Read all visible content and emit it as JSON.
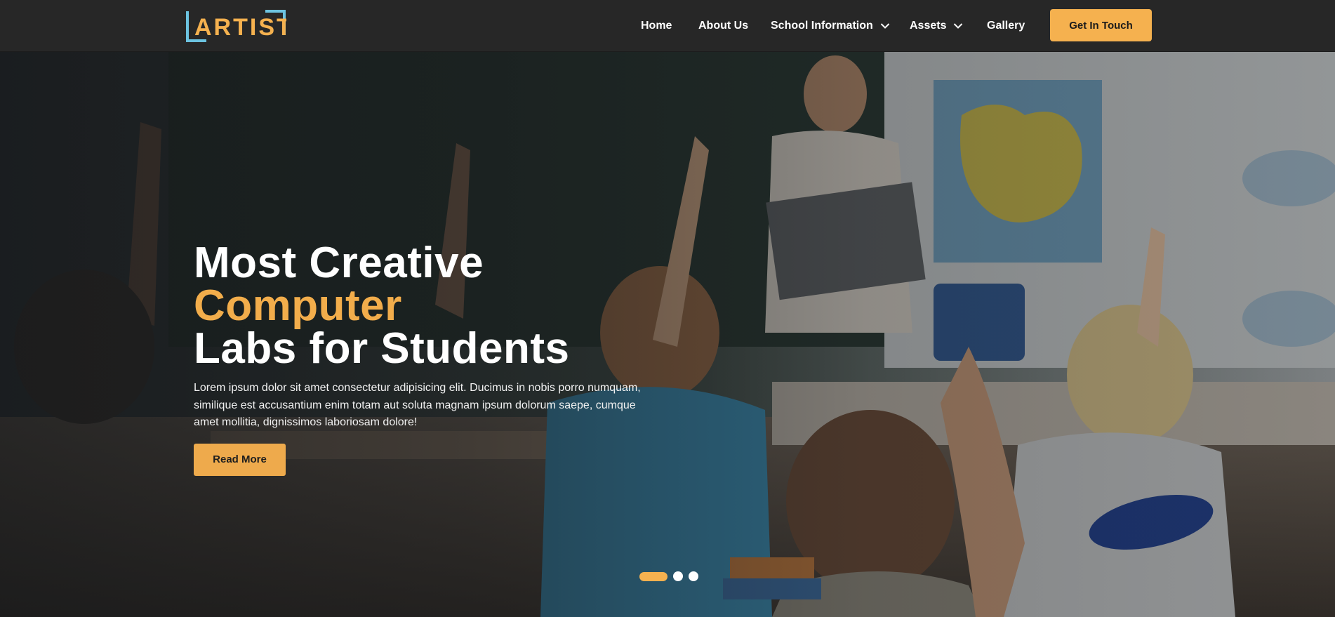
{
  "logo": {
    "text": "ARTIST",
    "alt": "Artist logo"
  },
  "nav": {
    "items": [
      {
        "label": "Home"
      },
      {
        "label": "About Us"
      },
      {
        "label": "School Information",
        "has_dropdown": true
      },
      {
        "label": "Assets",
        "has_dropdown": true
      },
      {
        "label": "Gallery"
      }
    ],
    "cta_label": "Get In Touch"
  },
  "hero": {
    "title_part1": "Most Creative ",
    "title_accent": "Computer",
    "title_part2": "Labs for Students",
    "description": "Lorem ipsum dolor sit amet consectetur adipisicing elit. Ducimus in nobis porro numquam, similique est accusantium enim totam aut soluta magnam ipsum dolorum saepe, cumque amet mollitia, dignissimos laboriosam dolore!",
    "button_label": "Read More",
    "slider": {
      "total_slides": 3,
      "active_index": 0
    }
  },
  "colors": {
    "accent": "#f5b14f",
    "header_bg": "#272727",
    "logo_blue": "#6cc3e0",
    "logo_yellow": "#f5b14f"
  }
}
